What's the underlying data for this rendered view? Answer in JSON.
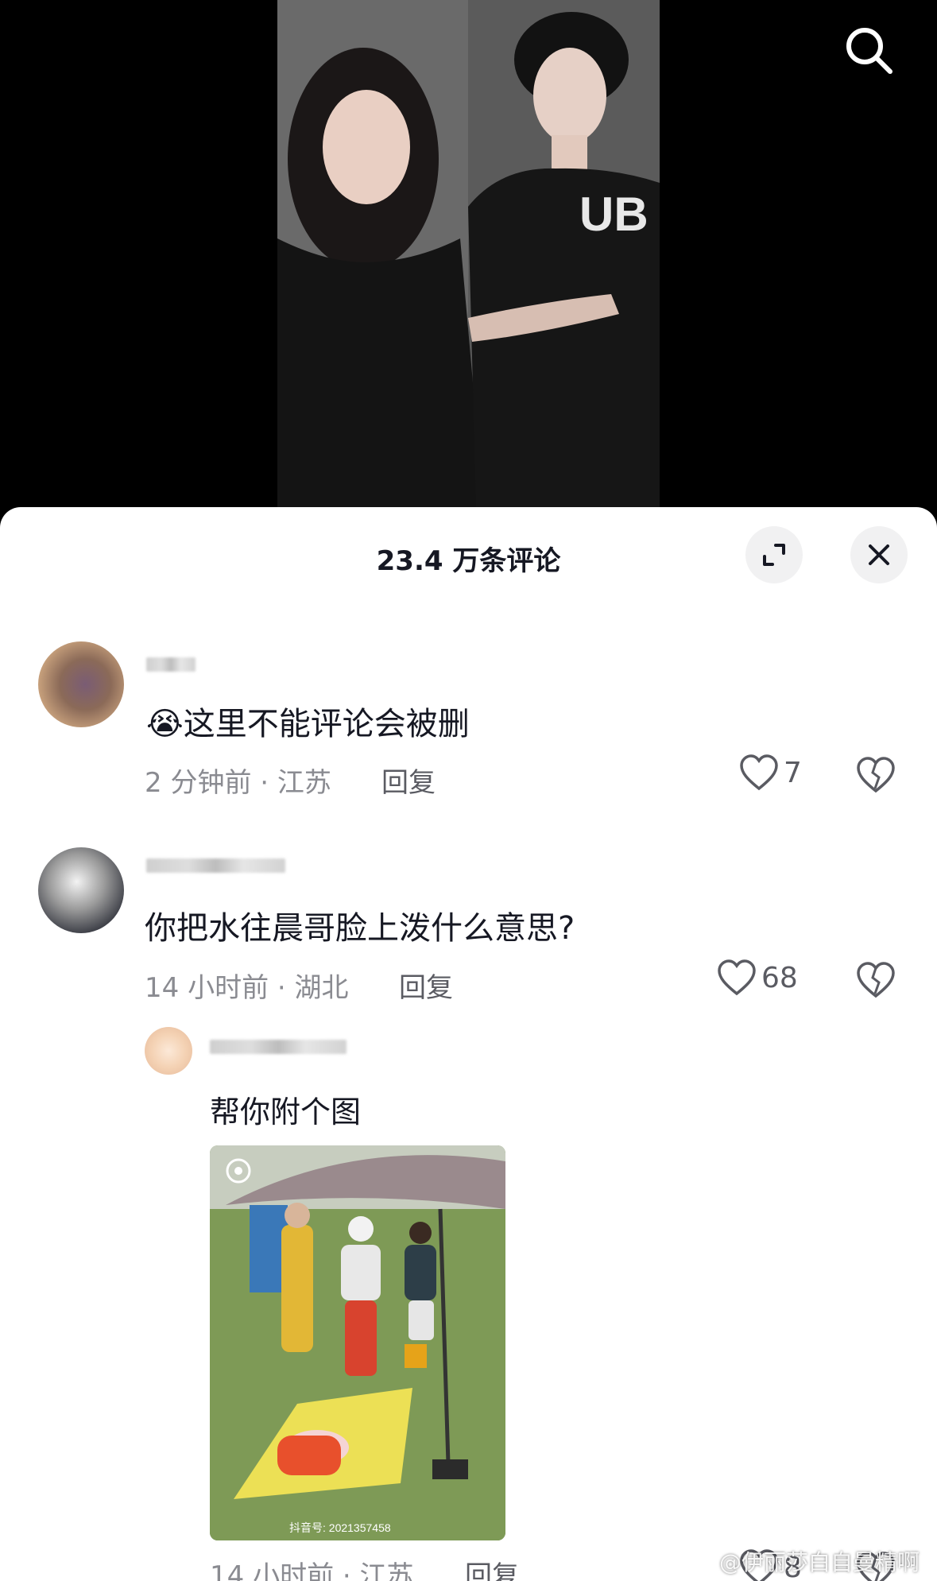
{
  "header": {
    "comment_count_title": "23.4 万条评论"
  },
  "comments": [
    {
      "text": "这里不能评论会被删",
      "emoji": "😭",
      "time_location": "2 分钟前 · 江苏",
      "reply_label": "回复",
      "likes": "7"
    },
    {
      "text": "你把水往晨哥脸上泼什么意思?",
      "time_location": "14 小时前 · 湖北",
      "reply_label": "回复",
      "likes": "68"
    }
  ],
  "reply": {
    "text": "帮你附个图",
    "image_watermark": "抖音号: 2021357458",
    "time_location": "14 小时前 · 江苏",
    "reply_label": "回复",
    "likes": "8"
  },
  "page_watermark": "@伊丽莎白自曼精啊",
  "colors": {
    "sheet_bg": "#ffffff",
    "text_primary": "#161823",
    "text_secondary": "#8a8b91",
    "icon_button_bg": "#f1f1f2"
  }
}
